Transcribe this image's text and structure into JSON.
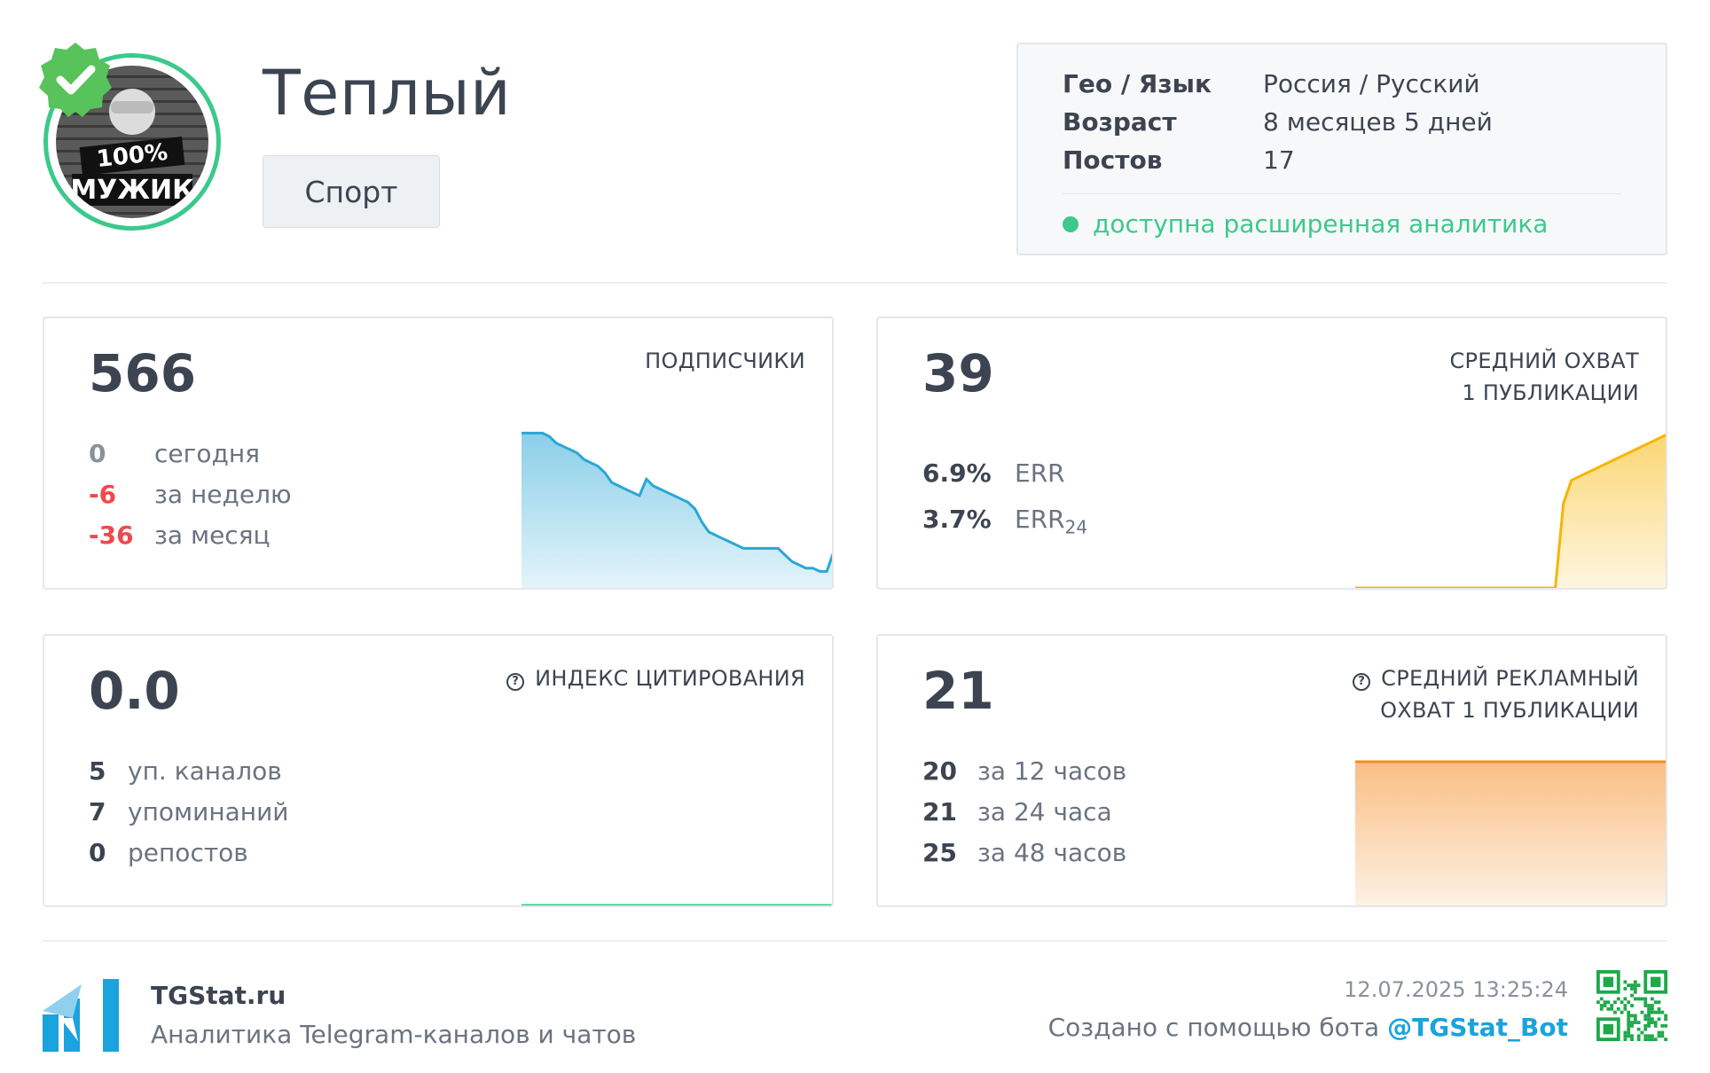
{
  "channel": {
    "title": "Теплый",
    "category": "Спорт",
    "avatar_text_line1": "100%",
    "avatar_text_line2": "МУЖИК"
  },
  "info": {
    "rows": [
      {
        "key": "Гео / Язык",
        "value": "Россия / Русский"
      },
      {
        "key": "Возраст",
        "value": "8 месяцев 5 дней"
      },
      {
        "key": "Постов",
        "value": "17"
      }
    ],
    "analytics": "доступна расширенная аналитика"
  },
  "cards": {
    "subscribers": {
      "value": "566",
      "label": "ПОДПИСЧИКИ",
      "stats": [
        {
          "value": "0",
          "text": "сегодня",
          "color": "#8a919c"
        },
        {
          "value": "-6",
          "text": "за неделю",
          "color": "#f0474e"
        },
        {
          "value": "-36",
          "text": "за месяц",
          "color": "#f0474e"
        }
      ]
    },
    "reach": {
      "value": "39",
      "label_line1": "СРЕДНИЙ ОХВАТ",
      "label_line2": "1 ПУБЛИКАЦИИ",
      "stats": [
        {
          "value": "6.9%",
          "text": "ERR",
          "sub": ""
        },
        {
          "value": "3.7%",
          "text": "ERR",
          "sub": "24"
        }
      ]
    },
    "citation": {
      "value": "0.0",
      "label": "ИНДЕКС ЦИТИРОВАНИЯ",
      "stats": [
        {
          "value": "5",
          "text": "уп. каналов"
        },
        {
          "value": "7",
          "text": "упоминаний"
        },
        {
          "value": "0",
          "text": "репостов"
        }
      ]
    },
    "ad_reach": {
      "value": "21",
      "label_line1": "СРЕДНИЙ РЕКЛАМНЫЙ",
      "label_line2": "ОХВАТ 1 ПУБЛИКАЦИИ",
      "stats": [
        {
          "value": "20",
          "text": "за 12 часов"
        },
        {
          "value": "21",
          "text": "за 24 часа"
        },
        {
          "value": "25",
          "text": "за 48 часов"
        }
      ]
    }
  },
  "sparklines": {
    "subscribers": {
      "color": "#2aa7d6",
      "values": [
        602,
        602,
        602,
        602,
        601,
        599,
        598,
        597,
        596,
        594,
        593,
        592,
        590,
        587,
        586,
        585,
        584,
        583,
        588,
        586,
        585,
        584,
        583,
        582,
        581,
        579,
        575,
        572,
        571,
        570,
        569,
        568,
        567,
        567,
        567,
        567,
        567,
        567,
        565,
        563,
        562,
        561,
        561,
        560,
        560,
        566
      ]
    },
    "reach": {
      "color": "#f7b500",
      "values": [
        0,
        0,
        0,
        0,
        0,
        0,
        0,
        0,
        0,
        0,
        0,
        0,
        0,
        0,
        0,
        0,
        0,
        0,
        0,
        0,
        0,
        0,
        0,
        0,
        0,
        0,
        22,
        28,
        29,
        30,
        31,
        32,
        33,
        34,
        35,
        36,
        37,
        38,
        39,
        40
      ]
    },
    "citation": {
      "color": "#3cc98c",
      "values": [
        0,
        0
      ]
    },
    "ad_reach": {
      "color": "#f58a1f",
      "values": [
        21,
        21
      ]
    }
  },
  "footer": {
    "brand": "TGStat.ru",
    "subtitle": "Аналитика Telegram-каналов и чатов",
    "date": "12.07.2025 13:25:24",
    "created_prefix": "Создано с помощью бота ",
    "bot": "@TGStat_Bot"
  },
  "colors": {
    "accent_green": "#3cc98c",
    "accent_blue": "#1aa3dc",
    "negative": "#f0474e",
    "text": "#3d4451"
  }
}
